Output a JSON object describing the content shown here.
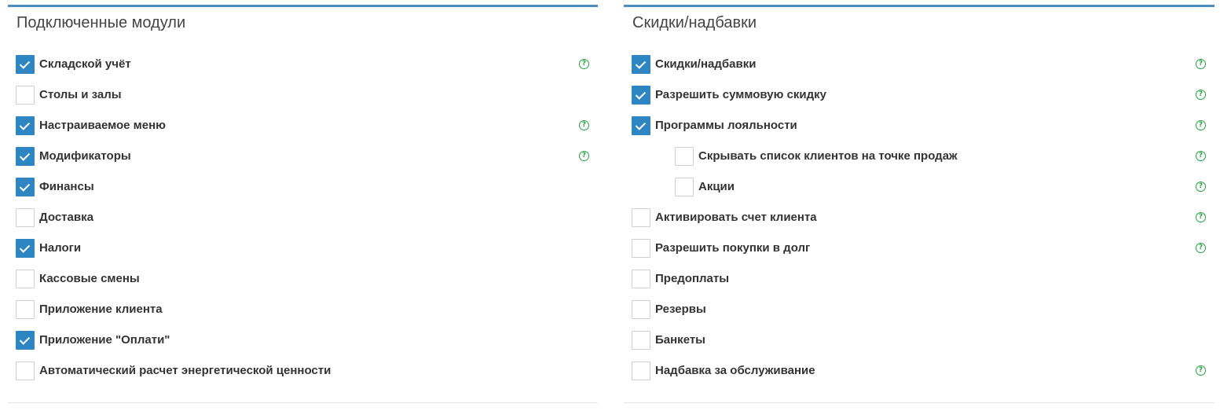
{
  "left_panel": {
    "title": "Подключенные модули",
    "items": [
      {
        "label": "Складской учёт",
        "checked": true,
        "help": true
      },
      {
        "label": "Столы и залы",
        "checked": false,
        "help": false
      },
      {
        "label": "Настраиваемое меню",
        "checked": true,
        "help": true
      },
      {
        "label": "Модификаторы",
        "checked": true,
        "help": true
      },
      {
        "label": "Финансы",
        "checked": true,
        "help": false
      },
      {
        "label": "Доставка",
        "checked": false,
        "help": false
      },
      {
        "label": "Налоги",
        "checked": true,
        "help": false
      },
      {
        "label": "Кассовые смены",
        "checked": false,
        "help": false
      },
      {
        "label": "Приложение клиента",
        "checked": false,
        "help": false
      },
      {
        "label": "Приложение \"Оплати\"",
        "checked": true,
        "help": false
      },
      {
        "label": "Автоматический расчет энергетической ценности",
        "checked": false,
        "help": false
      }
    ]
  },
  "right_panel": {
    "title": "Скидки/надбавки",
    "items": [
      {
        "label": "Скидки/надбавки",
        "checked": true,
        "help": true,
        "indent": false
      },
      {
        "label": "Разрешить суммовую скидку",
        "checked": true,
        "help": true,
        "indent": false
      },
      {
        "label": "Программы лояльности",
        "checked": true,
        "help": true,
        "indent": false
      },
      {
        "label": "Скрывать список клиентов на точке продаж",
        "checked": false,
        "help": true,
        "indent": true
      },
      {
        "label": "Акции",
        "checked": false,
        "help": true,
        "indent": true
      },
      {
        "label": "Активировать счет клиента",
        "checked": false,
        "help": true,
        "indent": false
      },
      {
        "label": "Разрешить покупки в долг",
        "checked": false,
        "help": true,
        "indent": false
      },
      {
        "label": "Предоплаты",
        "checked": false,
        "help": false,
        "indent": false
      },
      {
        "label": "Резервы",
        "checked": false,
        "help": false,
        "indent": false
      },
      {
        "label": "Банкеты",
        "checked": false,
        "help": false,
        "indent": false
      },
      {
        "label": "Надбавка за обслуживание",
        "checked": false,
        "help": true,
        "indent": false
      }
    ]
  },
  "icons": {
    "checkbox_checked": "checkmark-icon",
    "help": "question-circle-icon"
  },
  "colors": {
    "accent": "#2d86c2",
    "panel_border": "#4a8ec1",
    "help_icon": "#27a245"
  }
}
